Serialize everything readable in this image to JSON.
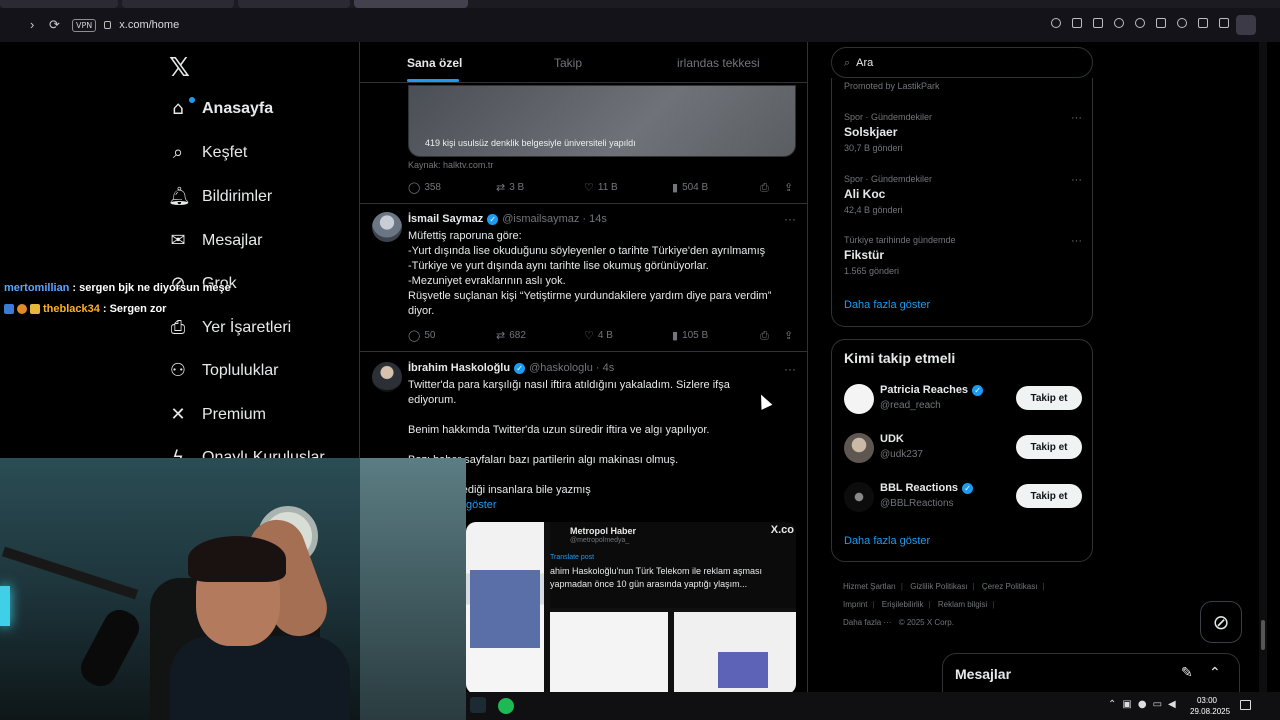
{
  "browser": {
    "url": "x.com/home",
    "vpn_label": "VPN"
  },
  "nav": {
    "items": [
      {
        "label": "Anasayfa",
        "icon": "home-icon"
      },
      {
        "label": "Keşfet",
        "icon": "search-icon"
      },
      {
        "label": "Bildirimler",
        "icon": "bell-icon"
      },
      {
        "label": "Mesajlar",
        "icon": "mail-icon"
      },
      {
        "label": "Grok",
        "icon": "grok-icon"
      },
      {
        "label": "Yer İşaretleri",
        "icon": "bookmark-icon"
      },
      {
        "label": "Topluluklar",
        "icon": "communities-icon"
      },
      {
        "label": "Premium",
        "icon": "x-icon"
      },
      {
        "label": "Onaylı Kuruluşlar",
        "icon": "lightning-icon"
      }
    ]
  },
  "timeline": {
    "tabs": [
      "Sana özel",
      "Takip",
      "irlandas tekkesi"
    ],
    "card": {
      "caption": "419 kişi usulsüz denklik belgesiyle üniversiteli yapıldı",
      "source": "Kaynak: halktv.com.tr",
      "replies": "358",
      "reposts": "3 B",
      "likes": "11 B",
      "views": "504 B"
    },
    "post1": {
      "name": "İsmail Saymaz",
      "handle": "@ismailsaymaz · 14s",
      "lines": [
        "Müfettiş raporuna göre:",
        "-Yurt dışında lise okuduğunu söyleyenler o tarihte Türkiye'den ayrılmamış",
        "-Türkiye ve yurt dışında aynı tarihte lise okumuş görünüyorlar.",
        "-Mezuniyet evraklarının aslı yok.",
        "Rüşvetle suçlanan kişi “Yetiştirme yurdundakilere yardım diye para verdim” diyor."
      ],
      "replies": "50",
      "reposts": "682",
      "likes": "4 B",
      "views": "105 B"
    },
    "post2": {
      "name": "İbrahim Haskoloğlu",
      "handle": "@haskologlu · 4s",
      "lines": [
        "Twitter'da para karşılığı nasıl iftira atıldığını yakaladım. Sizlere ifşa ediyorum.",
        "Benim hakkımda Twitter'da uzun süredir iftira ve algı yapılıyor.",
        "Bazı haber sayfaları bazı partilerin algı makinası olmuş.",
        "dığımı bilmediği insanlara bile yazmış"
      ],
      "show_more": "göster",
      "media_source": "Metropol Haber",
      "media_handle": "@metropolmedya_",
      "media_translate": "Translate post",
      "media_text": "ahim Haskoloğlu'nun Türk Telekom ile reklam aşması yapmadan önce 10 gün arasında yaptığı ylaşım...",
      "media_x": "X.co"
    }
  },
  "right": {
    "search_placeholder": "Ara",
    "promoted": "Promoted by LastikPark",
    "trends": [
      {
        "category": "Spor · Gündemdekiler",
        "name": "Solskjaer",
        "count": "30,7 B gönderi"
      },
      {
        "category": "Spor · Gündemdekiler",
        "name": "Ali Koc",
        "count": "42,4 B gönderi"
      },
      {
        "category": "Türkiye tarihinde gündemde",
        "name": "Fikstür",
        "count": "1.565 gönderi"
      }
    ],
    "show_more": "Daha fazla göster",
    "who_title": "Kimi takip etmeli",
    "who": [
      {
        "name": "Patricia Reaches",
        "handle": "@read_reach",
        "verified": true
      },
      {
        "name": "UDK",
        "handle": "@udk237",
        "verified": false
      },
      {
        "name": "BBL Reactions",
        "handle": "@BBLReactions",
        "verified": true
      }
    ],
    "follow_label": "Takip et",
    "who_show_more": "Daha fazla göster",
    "footer": [
      "Hizmet Şartları",
      "Gizlilik Politikası",
      "Çerez Politikası",
      "Imprint",
      "Erişilebilirlik",
      "Reklam bilgisi",
      "Daha fazla ···",
      "© 2025 X Corp."
    ]
  },
  "messages_drawer": {
    "title": "Mesajlar"
  },
  "chat": [
    {
      "user": "mertomillian",
      "text": ": sergen bjk ne diyorsun meşe"
    },
    {
      "user": "theblack34",
      "text": ": Sergen zor"
    }
  ],
  "clock": {
    "time": "03:00",
    "date": "29.08.2025"
  },
  "colors": {
    "accent": "#1d9bf0",
    "background": "#000000",
    "border": "#2f3336",
    "muted": "#71767b"
  }
}
